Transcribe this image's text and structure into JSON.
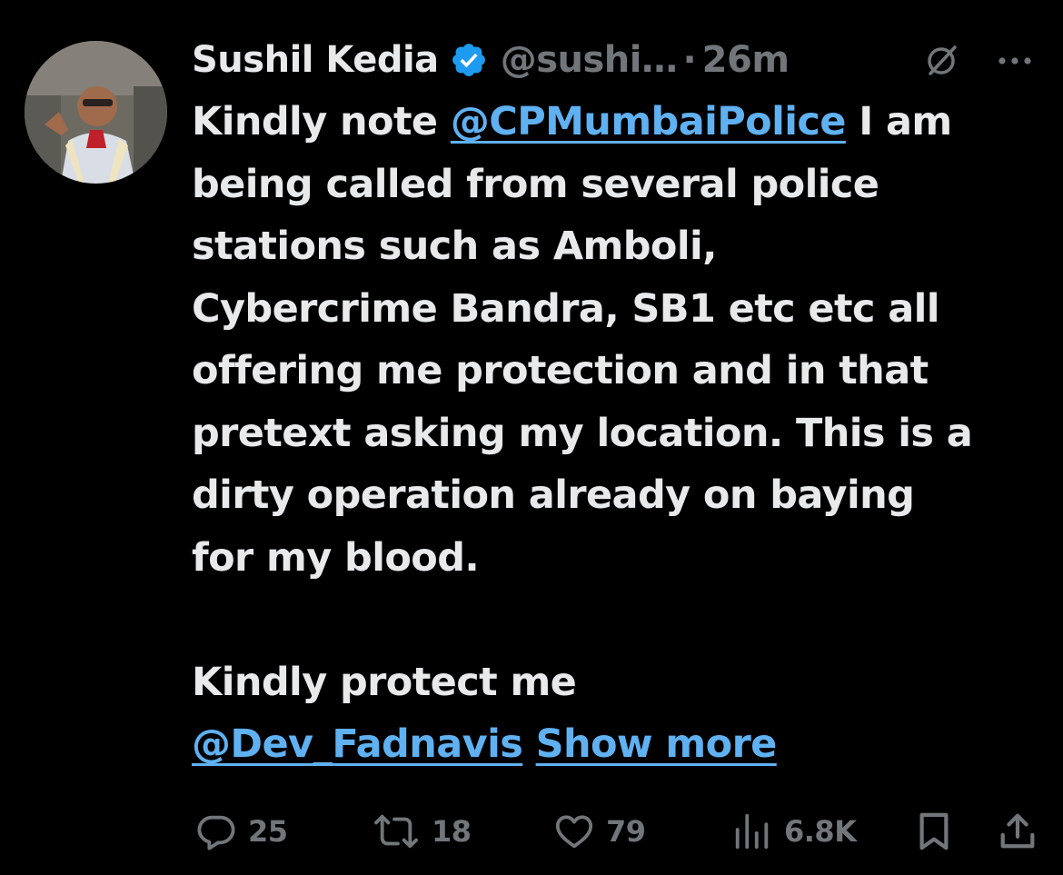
{
  "author": {
    "name": "Sushil Kedia",
    "handle": "@sushi…",
    "separator": "·",
    "time": "26m",
    "verified": true
  },
  "tweet": {
    "lines": [
      [
        {
          "text": "Kindly note ",
          "type": "text"
        },
        {
          "text": "@CPMumbaiPolice",
          "type": "mention"
        },
        {
          "text": " I am",
          "type": "text"
        }
      ],
      [
        {
          "text": "being called from several police",
          "type": "text"
        }
      ],
      [
        {
          "text": "stations such as Amboli,",
          "type": "text"
        }
      ],
      [
        {
          "text": "Cybercrime Bandra, SB1 etc etc all",
          "type": "text"
        }
      ],
      [
        {
          "text": "offering me protection and in that",
          "type": "text"
        }
      ],
      [
        {
          "text": "pretext asking my location. This is a",
          "type": "text"
        }
      ],
      [
        {
          "text": "dirty operation already on baying",
          "type": "text"
        }
      ],
      [
        {
          "text": "for my blood.",
          "type": "text"
        }
      ],
      [],
      [
        {
          "text": "Kindly protect me",
          "type": "text"
        }
      ],
      [
        {
          "text": "@Dev_Fadnavis",
          "type": "mention"
        },
        {
          "text": " ",
          "type": "text"
        },
        {
          "text": "Show more",
          "type": "show-more"
        }
      ]
    ]
  },
  "actions": {
    "reply_count": "25",
    "retweet_count": "18",
    "like_count": "79",
    "view_count": "6.8K"
  },
  "icons": {
    "reply": "reply-icon",
    "retweet": "retweet-icon",
    "like": "heart-icon",
    "views": "views-icon",
    "bookmark": "bookmark-icon",
    "share": "share-icon",
    "grok": "grok-icon",
    "more": "more-icon",
    "verified": "verified-badge-icon"
  },
  "colors": {
    "background": "#000000",
    "text": "#e7e9ea",
    "muted": "#71767b",
    "link": "#5fb1f2",
    "verified": "#1d9bf0"
  }
}
